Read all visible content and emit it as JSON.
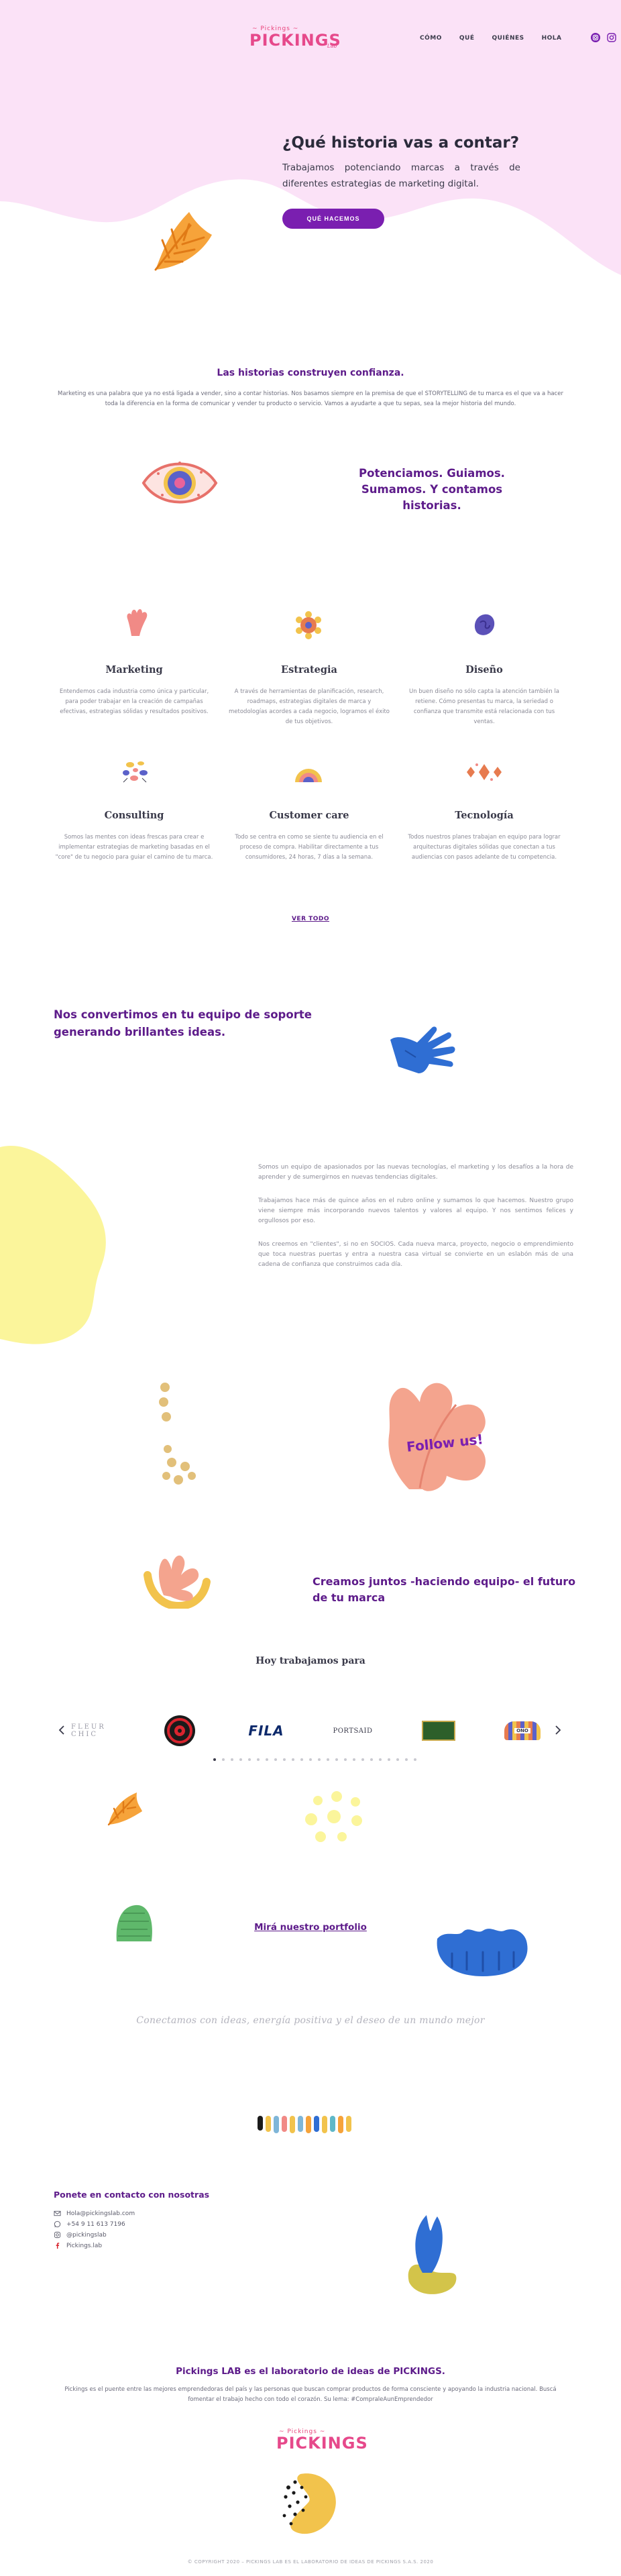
{
  "brand": {
    "small": "~ Pickings ~",
    "word": "PICKINGS",
    "lab": "Lab"
  },
  "nav": {
    "items": [
      "CÓMO",
      "QUÉ",
      "QUIÉNES",
      "HOLA"
    ]
  },
  "social_icons": [
    "instagram-icon",
    "instagram-icon"
  ],
  "hero": {
    "title": "¿Qué historia vas a contar?",
    "subtitle": "Trabajamos potenciando marcas a través de diferentes estrategias de marketing digital.",
    "cta": "QUÉ HACEMOS"
  },
  "stories": {
    "title": "Las historias construyen confianza.",
    "text": "Marketing es una palabra que ya no está ligada a vender, sino a contar historias. Nos basamos siempre en la premisa de que el STORYTELLING de tu marca es el que va a hacer toda la diferencia en la forma de comunicar y vender tu producto o servicio. Vamos a ayudarte a que tu sepas, sea la mejor historia del mundo."
  },
  "potenciamos": {
    "text": "Potenciamos. Guiamos. Sumamos. Y contamos historias."
  },
  "services": [
    {
      "title": "Marketing",
      "desc": "Entendemos cada industria como única y particular, para poder trabajar en la creación de campañas efectivas, estrategias sólidas y resultados positivos."
    },
    {
      "title": "Estrategia",
      "desc": "A través de herramientas de planificación, research, roadmaps, estrategias digitales de marca y metodologías acordes a cada negocio, logramos el éxito de tus objetivos."
    },
    {
      "title": "Diseño",
      "desc": "Un buen diseño no sólo capta la atención también la retiene. Cómo presentas tu marca, la seriedad o confianza que transmite está relacionada con tus ventas."
    },
    {
      "title": "Consulting",
      "desc": "Somos las mentes con ideas frescas para crear e implementar estrategias de marketing basadas en el \"core\" de tu negocio para guiar el camino de tu marca."
    },
    {
      "title": "Customer care",
      "desc": "Todo se centra en como se siente tu audiencia en el proceso de compra. Habilitar directamente a tus consumidores, 24 horas, 7 días a la semana."
    },
    {
      "title": "Tecnología",
      "desc": "Todos nuestros planes trabajan en equipo para lograr arquitecturas digitales sólidas que conectan a tus audiencias con pasos adelante de tu competencia."
    }
  ],
  "see_all": "VER TODO",
  "team": {
    "title": "Nos convertimos en tu equipo de soporte generando brillantes ideas.",
    "p1": "Somos un equipo de apasionados por las nuevas tecnologías, el marketing y los desafíos a la hora de aprender y de sumergirnos en nuevas tendencias digitales.",
    "p2": "Trabajamos hace más de quince años en el rubro online y sumamos lo que hacemos. Nuestro grupo viene siempre más incorporando nuevos talentos y valores al equipo. Y nos sentimos felices y orgullosos por eso.",
    "p3": "Nos creemos en \"clientes\", si no en SOCIOS. Cada nueva marca, proyecto, negocio o emprendimiento que toca nuestras puertas y entra a nuestra casa virtual se convierte en un eslabón más de una cadena de confianza que construimos cada día."
  },
  "follow": "Follow us!",
  "create": {
    "title": "Creamos juntos -haciendo equipo- el futuro de tu marca"
  },
  "clients": {
    "title": "Hoy trabajamos para",
    "logos": [
      "FLEUR CHIC",
      "FILA",
      "PORTSAID",
      "",
      "ONO"
    ]
  },
  "portfolio": {
    "link": "Mirá nuestro portfolio"
  },
  "tagline": "Conectamos con ideas, energía positiva y el deseo de un mundo mejor",
  "contact": {
    "title": "Ponete en contacto con nosotras",
    "items": [
      {
        "icon": "mail-icon",
        "text": "Hola@pickingslab.com"
      },
      {
        "icon": "whatsapp-icon",
        "text": "+54 9 11 613 7196"
      },
      {
        "icon": "instagram-icon",
        "text": "@pickingslab"
      },
      {
        "icon": "facebook-icon",
        "text": "Pickings.lab"
      }
    ]
  },
  "footer": {
    "title": "Pickings LAB es el laboratorio de ideas de PICKINGS.",
    "text": "Pickings es el puente entre las mejores emprendedoras del país y las personas que buscan comprar productos de forma consciente y apoyando la industria nacional. Buscá fomentar el trabajo hecho con todo el corazón. Su lema: #CompraleAunEmprendedor",
    "copyright": "© COPYRIGHT 2020 – PICKINGS LAB ES EL LABORATORIO DE IDEAS DE PICKINGS S.A.S. 2020"
  },
  "colors": {
    "purple": "#5d1b8a",
    "button": "#7a1fb0",
    "pink": "#e6498b",
    "hero_bg": "#fbe2f7",
    "yellow": "#fbf59b",
    "blue": "#2f6ed3",
    "salmon": "#f4a48e"
  }
}
